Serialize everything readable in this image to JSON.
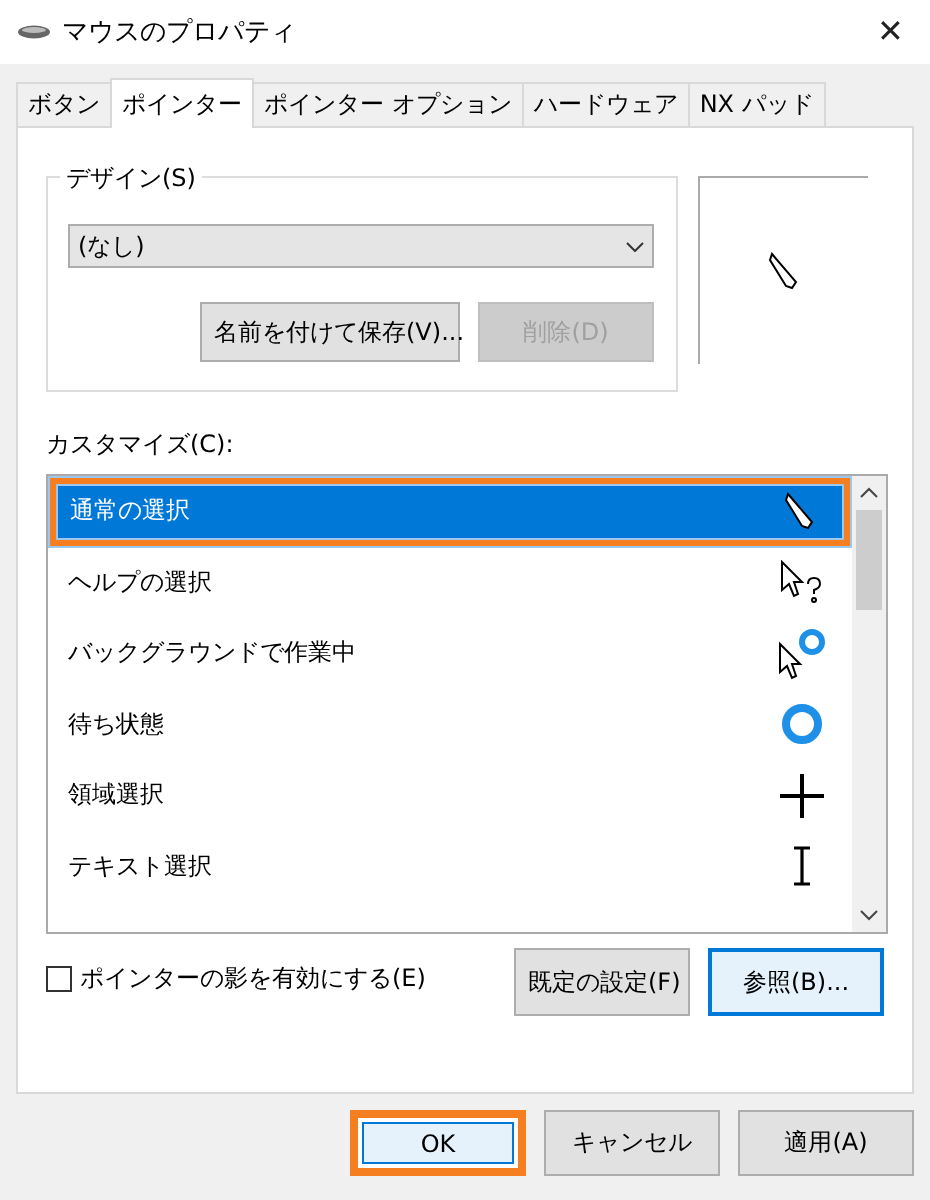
{
  "window": {
    "title": "マウスのプロパティ",
    "close": "✕"
  },
  "tabs": [
    {
      "label": "ボタン",
      "selected": false
    },
    {
      "label": "ポインター",
      "selected": true
    },
    {
      "label": "ポインター オプション",
      "selected": false
    },
    {
      "label": "ハードウェア",
      "selected": false
    },
    {
      "label": "NX パッド",
      "selected": false
    }
  ],
  "design": {
    "legend": "デザイン(S)",
    "value": "(なし)",
    "buttons": [
      {
        "label": "名前を付けて保存(V)...",
        "disabled": false
      },
      {
        "label": "削除(D)",
        "disabled": true
      }
    ]
  },
  "customize": {
    "label": "カスタマイズ(C):",
    "rows": [
      {
        "name": "通常の選択",
        "kind": "pen",
        "selected": true,
        "highlighted": true
      },
      {
        "name": "ヘルプの選択",
        "kind": "help",
        "selected": false,
        "highlighted": false
      },
      {
        "name": "バックグラウンドで作業中",
        "kind": "working",
        "selected": false,
        "highlighted": false
      },
      {
        "name": "待ち状態",
        "kind": "busy",
        "selected": false,
        "highlighted": false
      },
      {
        "name": "領域選択",
        "kind": "cross",
        "selected": false,
        "highlighted": false
      },
      {
        "name": "テキスト選択",
        "kind": "text",
        "selected": false,
        "highlighted": false
      }
    ]
  },
  "shadow": {
    "label": "ポインターの影を有効にする(E)",
    "checked": false
  },
  "list_buttons": [
    {
      "label": "既定の設定(F)",
      "focused": false
    },
    {
      "label": "参照(B)...",
      "focused": true
    }
  ],
  "dialog_buttons": [
    {
      "label": "OK",
      "focused": true,
      "highlighted": true
    },
    {
      "label": "キャンセル",
      "focused": false,
      "highlighted": false
    },
    {
      "label": "適用(A)",
      "focused": false,
      "highlighted": false
    }
  ]
}
